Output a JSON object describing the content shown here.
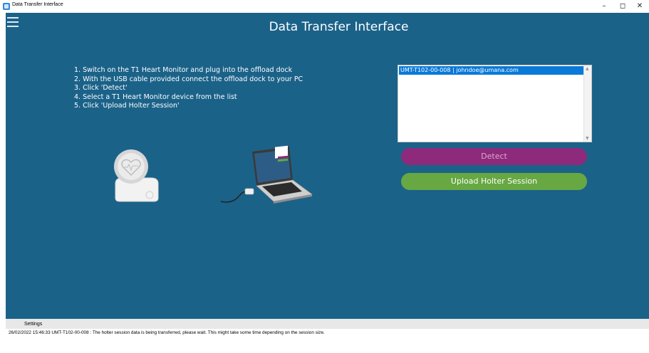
{
  "window": {
    "title": "Data Transfer Interface",
    "controls": {
      "minimize": "–",
      "maximize": "◻",
      "close": "✕"
    }
  },
  "header": {
    "title": "Data Transfer Interface",
    "menu_icon": "hamburger-menu-icon"
  },
  "instructions": [
    "1. Switch on the T1 Heart Monitor and plug into the offload dock",
    "2. With the USB cable provided connect the offload dock to your PC",
    "3. Click 'Detect'",
    "4. Select a T1 Heart Monitor device from the list",
    "5. Click 'Upload Holter Session'"
  ],
  "device_list": {
    "items": [
      "UMT-T102-00-008 | johndoe@umana.com"
    ],
    "selected_index": 0
  },
  "buttons": {
    "detect": "Detect",
    "upload": "Upload Holter Session"
  },
  "log": {
    "label": "Settings",
    "lines": [
      "26/02/2022 15:46:33 UMT-T102-00-008 : The holter session data is being transferred, please wait. This might take some time depending on the session size."
    ]
  },
  "colors": {
    "background": "#1b6289",
    "detect_button": "#8e2a7c",
    "upload_button": "#67a843",
    "selection": "#0a79d8"
  },
  "illustrations": {
    "heart_monitor": "heart-monitor-device-icon",
    "laptop": "laptop-with-dock-icon"
  }
}
